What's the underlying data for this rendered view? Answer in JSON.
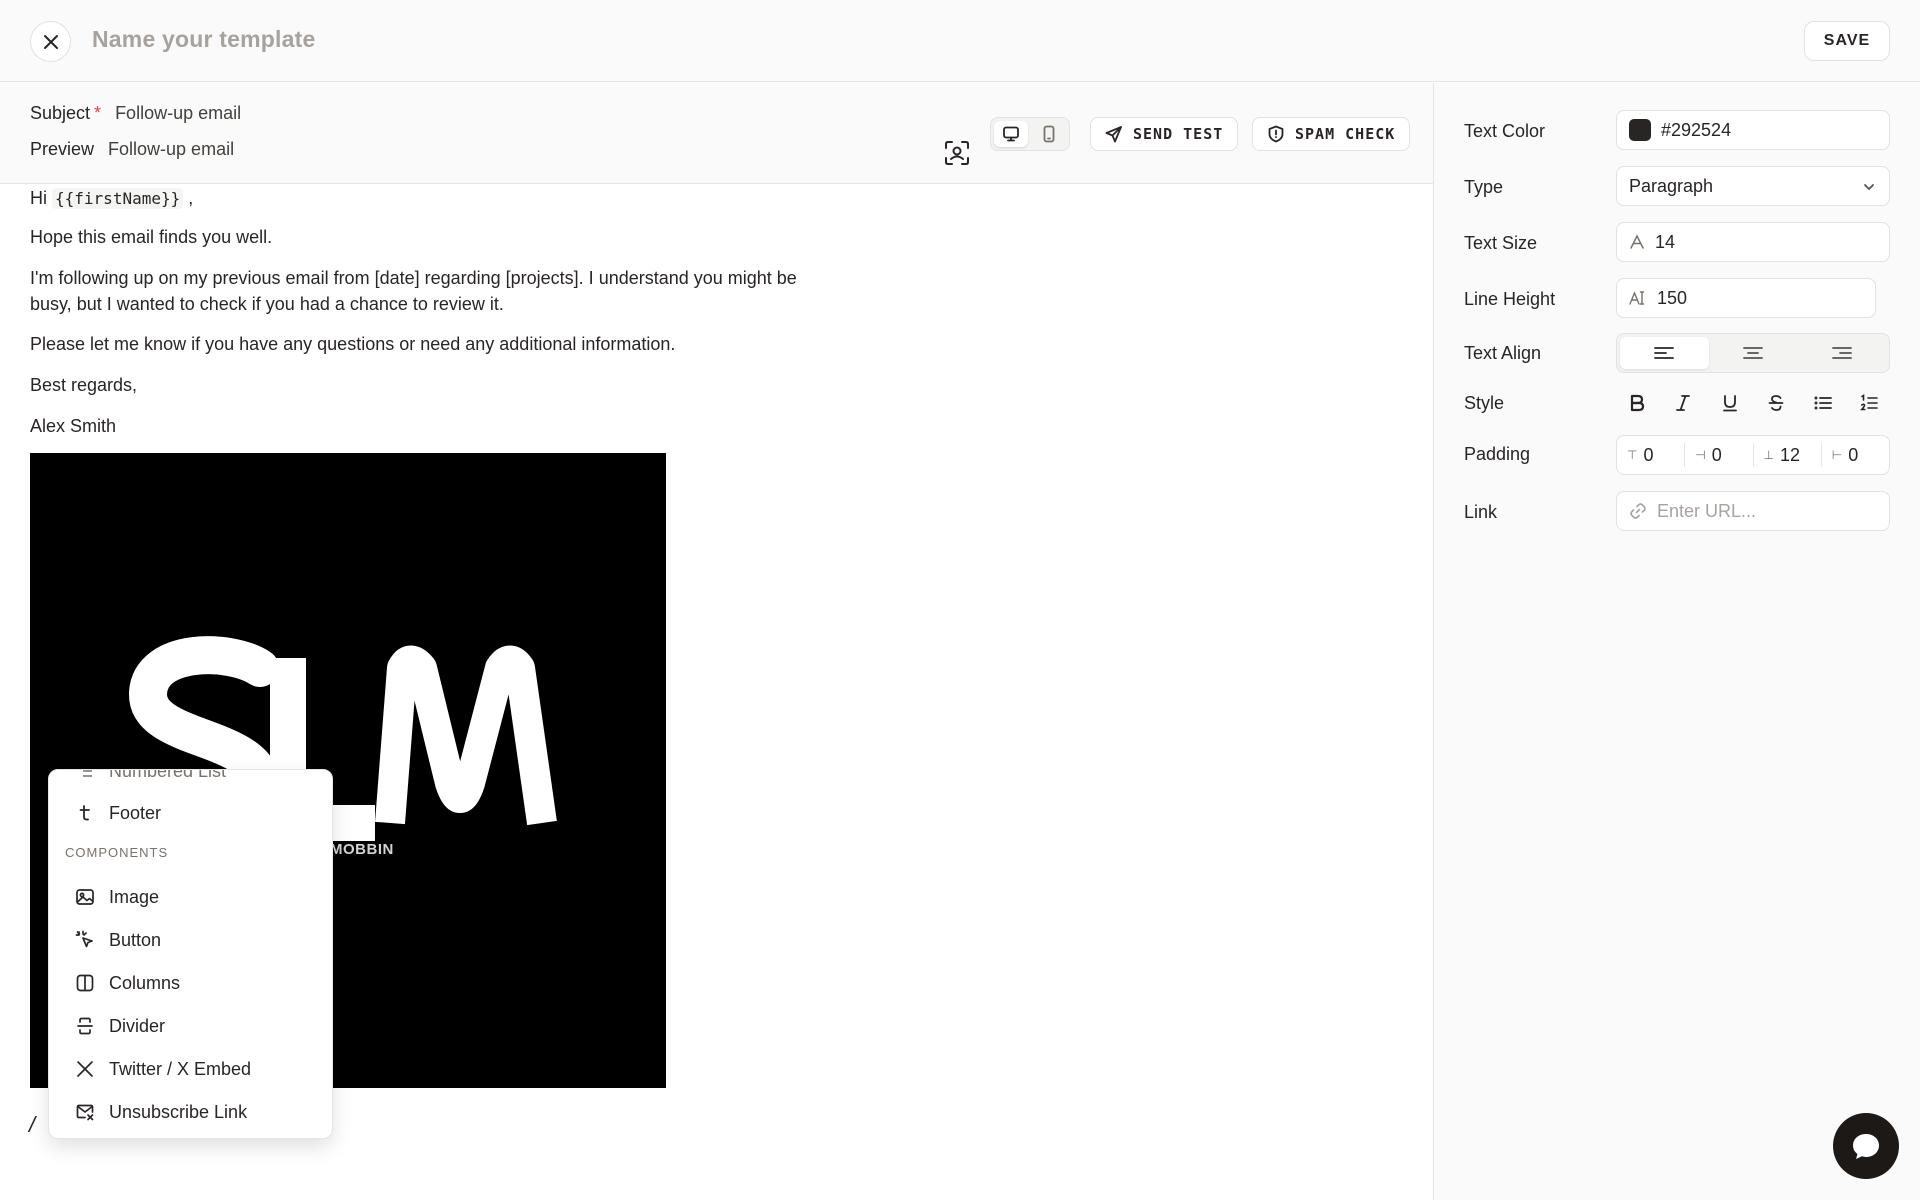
{
  "header": {
    "template_placeholder": "Name your template",
    "save_label": "SAVE"
  },
  "meta": {
    "subject_label": "Subject",
    "required_mark": "*",
    "subject_value": "Follow-up email",
    "preview_label": "Preview",
    "preview_value": "Follow-up email"
  },
  "toolbar": {
    "send_test_label": "SEND TEST",
    "spam_check_label": "SPAM CHECK",
    "active_device": "desktop"
  },
  "email": {
    "greeting_prefix": "Hi",
    "greeting_var": "{{firstName}}",
    "greeting_suffix": ",",
    "para1": "Hope this email finds you well.",
    "para2_line1": "I'm following up on my previous email from [date] regarding [projects]. I understand you might be",
    "para2_line2": "busy, but I wanted to check if you had a chance to review it.",
    "para3": "Please let me know if you have any questions or need any additional information.",
    "signoff": "Best regards,",
    "name": "Alex Smith",
    "image_caption": "MOBBIN",
    "cursor_glyph": "/"
  },
  "slash_menu": {
    "partial_item": "Numbered List",
    "footer_item": "Footer",
    "section_label": "COMPONENTS",
    "items": [
      {
        "label": "Image",
        "icon": "image-icon"
      },
      {
        "label": "Button",
        "icon": "pointer-click-icon"
      },
      {
        "label": "Columns",
        "icon": "columns-icon"
      },
      {
        "label": "Divider",
        "icon": "divider-icon"
      },
      {
        "label": "Twitter / X Embed",
        "icon": "x-logo-icon"
      },
      {
        "label": "Unsubscribe Link",
        "icon": "mail-x-icon"
      }
    ]
  },
  "panel": {
    "text_color_label": "Text Color",
    "text_color_value": "#292524",
    "type_label": "Type",
    "type_value": "Paragraph",
    "text_size_label": "Text Size",
    "text_size_value": "14",
    "line_height_label": "Line Height",
    "line_height_value": "150",
    "text_align_label": "Text Align",
    "text_align_active": "left",
    "style_label": "Style",
    "padding_label": "Padding",
    "padding_top": "0",
    "padding_right": "0",
    "padding_bottom": "12",
    "padding_left": "0",
    "link_label": "Link",
    "link_placeholder": "Enter URL..."
  },
  "colors": {
    "text": "#292524",
    "muted": "#a8a29e",
    "required": "#ef4444",
    "border": "#e2e2e2"
  }
}
